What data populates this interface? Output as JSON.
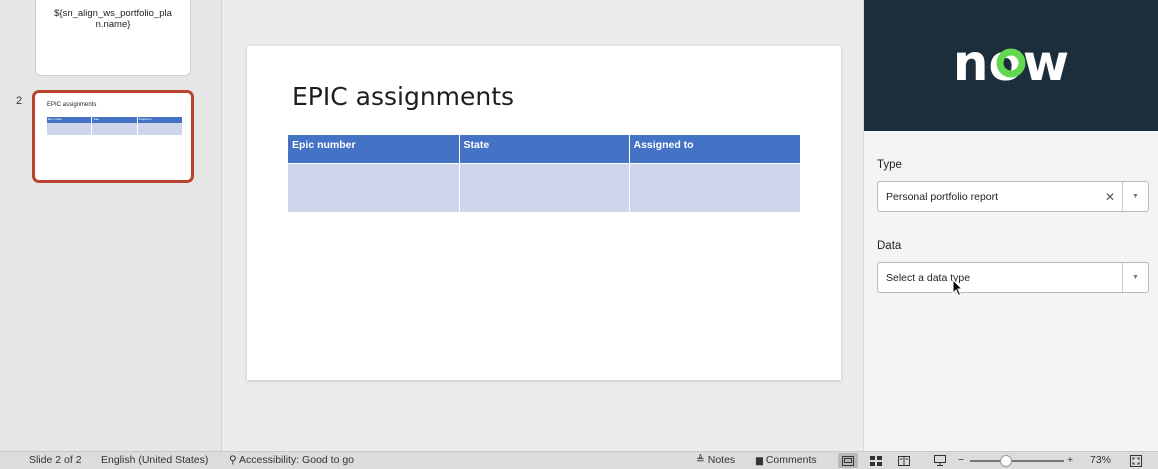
{
  "thumbnails": {
    "slide1_text": "${sn_align_ws_portfolio_pla n.name}",
    "slide2_number": "2",
    "slide2_title": "EPIC assignments",
    "slide2_headers": [
      "Epic number",
      "State",
      "Assigned to"
    ]
  },
  "slide": {
    "title": "EPIC assignments",
    "table": {
      "headers": [
        "Epic number",
        "State",
        "Assigned to"
      ],
      "rows": [
        [
          "",
          "",
          ""
        ]
      ]
    }
  },
  "panel": {
    "logo_text": "now",
    "type": {
      "label": "Type",
      "value": "Personal portfolio report",
      "clear_icon": "close-icon"
    },
    "data": {
      "label": "Data",
      "placeholder": "Select a data type"
    }
  },
  "status_bar": {
    "slide_info": "Slide 2 of 2",
    "language": "English (United States)",
    "accessibility": "Accessibility: Good to go",
    "notes": "Notes",
    "comments": "Comments",
    "zoom_minus": "−",
    "zoom_plus": "+",
    "zoom_level": "73%"
  },
  "colors": {
    "brand_bg": "#1c2d3b",
    "logo_green": "#62d84e",
    "table_header": "#4472c4",
    "table_body": "#cfd5ea",
    "selected_thumb_border": "#b8432f"
  }
}
